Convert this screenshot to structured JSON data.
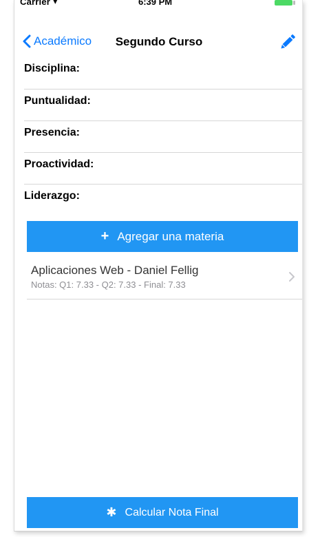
{
  "status_bar": {
    "carrier": "Carrier",
    "wifi_icon": "wifi-icon",
    "time": "6:39 PM",
    "battery_icon": "battery-icon"
  },
  "nav": {
    "back_label": "Académico",
    "title": "Segundo Curso",
    "edit_icon": "pencil-icon",
    "accent_color": "#0a7aff"
  },
  "form": {
    "rows": [
      {
        "label": "Disciplina:"
      },
      {
        "label": "Puntualidad:"
      },
      {
        "label": "Presencia:"
      },
      {
        "label": "Proactividad:"
      },
      {
        "label": "Liderazgo:"
      }
    ]
  },
  "add_button": {
    "icon": "plus-icon",
    "label": "Agregar una materia",
    "color": "#2196f3"
  },
  "subjects": [
    {
      "title": "Aplicaciones Web - Daniel Fellig",
      "notes": "Notas: Q1: 7.33 - Q2: 7.33 - Final: 7.33"
    }
  ],
  "calc_button": {
    "icon": "asterisk-icon",
    "label": "Calcular Nota Final"
  }
}
